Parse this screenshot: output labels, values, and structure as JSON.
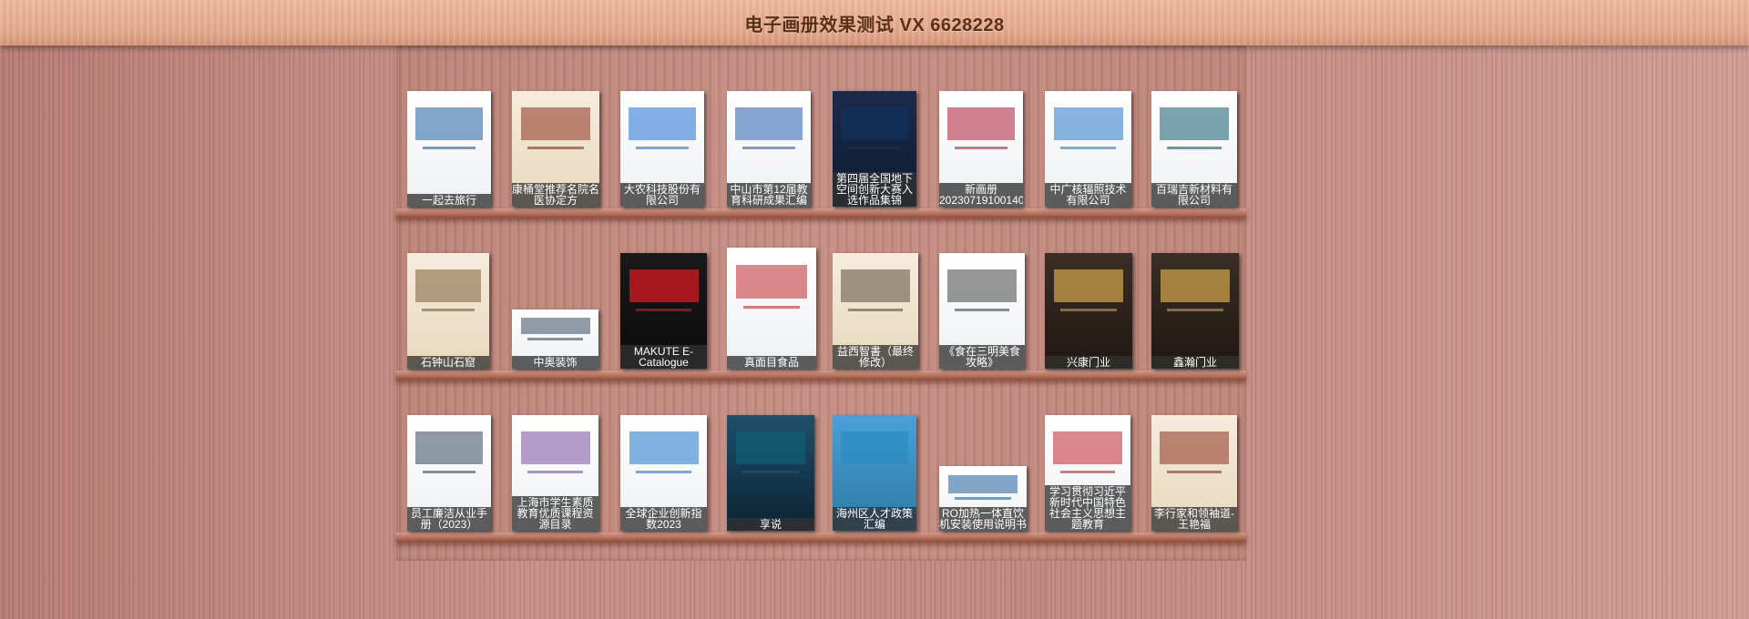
{
  "header": {
    "title": "电子画册效果测试 VX 6628228"
  },
  "shelves": [
    [
      {
        "caption": "一起去旅行",
        "theme": "white",
        "accent": "#1f5e9e",
        "icon": "travel-cover"
      },
      {
        "caption": "康桶堂推荐名院名医协定方",
        "theme": "cream",
        "accent": "#8a2d1e",
        "icon": "medicine-cover"
      },
      {
        "caption": "大农科技股份有限公司",
        "theme": "white",
        "accent": "#1e6fcf",
        "icon": "company-cover"
      },
      {
        "caption": "中山市第12届教育科研成果汇编",
        "theme": "white",
        "accent": "#2a5fb0",
        "icon": "education-cover"
      },
      {
        "caption": "第四届全国地下空间创新大赛入选作品集锦",
        "theme": "navy",
        "accent": "#12325e",
        "icon": "city-cover"
      },
      {
        "caption": "新画册20230719100140",
        "theme": "white",
        "accent": "#b01c3b",
        "icon": "photo-cover"
      },
      {
        "caption": "中广核辐照技术有限公司",
        "theme": "white",
        "accent": "#2877c8",
        "icon": "tech-cover"
      },
      {
        "caption": "百瑞吉新材料有限公司",
        "theme": "white",
        "accent": "#0e5a6e",
        "icon": "materials-cover"
      }
    ],
    [
      {
        "caption": "石钟山石窟",
        "theme": "cream",
        "accent": "#7c5c39",
        "icon": "grotto-cover"
      },
      {
        "caption": "中奥装饰",
        "theme": "white",
        "accent": "#3a4d5e",
        "icon": "decoration-cover"
      },
      {
        "caption": "MAKUTE E-Catalogue",
        "theme": "black",
        "accent": "#d71920",
        "icon": "makute-cover"
      },
      {
        "caption": "真面目食品",
        "theme": "white",
        "accent": "#c1262b",
        "icon": "food-cover"
      },
      {
        "caption": "益西智書（最终修改）",
        "theme": "cream",
        "accent": "#5a4a3a",
        "icon": "book-cover"
      },
      {
        "caption": "《食在三明美食攻略》",
        "theme": "white",
        "accent": "#444444",
        "icon": "cuisine-cover"
      },
      {
        "caption": "兴康门业",
        "theme": "dark",
        "accent": "#c9a04a",
        "icon": "door-cover"
      },
      {
        "caption": "鑫瀚门业",
        "theme": "dark",
        "accent": "#c9a04a",
        "icon": "door-cover"
      }
    ],
    [
      {
        "caption": "员工廉洁从业手册（2023）",
        "theme": "white",
        "accent": "#34495e",
        "icon": "handbook-cover"
      },
      {
        "caption": "上海市学生素质教育优质课程资源目录",
        "theme": "white",
        "accent": "#7a4fa3",
        "icon": "curriculum-cover"
      },
      {
        "caption": "全球企业创新指数2023",
        "theme": "white",
        "accent": "#1c77c9",
        "icon": "innovation-cover"
      },
      {
        "caption": "享说",
        "theme": "teal",
        "accent": "#0f5e74",
        "icon": "handshake-cover"
      },
      {
        "caption": "海州区人才政策汇编",
        "theme": "sky",
        "accent": "#2b8cc4",
        "icon": "policy-cover"
      },
      {
        "caption": "RO加热一体直饮机安装使用说明书",
        "theme": "white",
        "accent": "#1d5f9e",
        "icon": "manual-cover"
      },
      {
        "caption": "学习贯彻习近平新时代中国特色社会主义思想主题教育",
        "theme": "white",
        "accent": "#c1272d",
        "icon": "party-cover"
      },
      {
        "caption": "李行家和领袖道-王艳福",
        "theme": "cream",
        "accent": "#8a2d1e",
        "icon": "landscape-cover"
      }
    ]
  ]
}
